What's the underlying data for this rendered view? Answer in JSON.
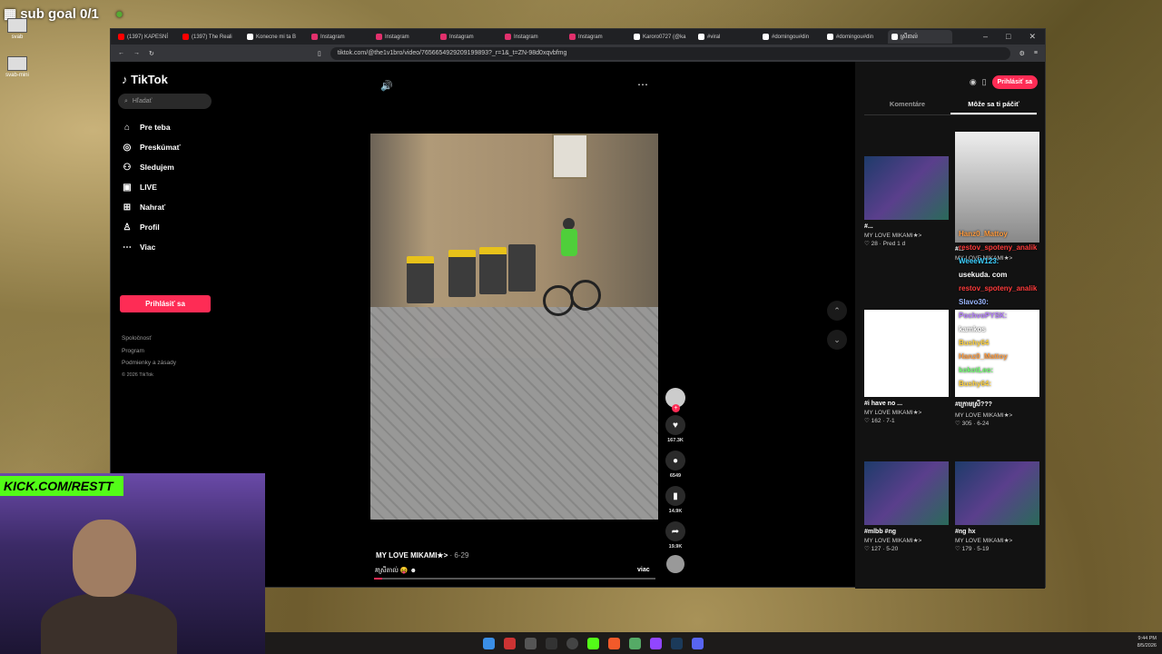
{
  "overlay": {
    "sub_goal": "sub goal 0/1"
  },
  "desktop": {
    "icons": [
      "svab",
      "svab-mini"
    ]
  },
  "browser": {
    "tabs": [
      {
        "label": "(1397) KAPESNÍ",
        "color": "#ff0000"
      },
      {
        "label": "(1397) The Reali",
        "color": "#ff0000"
      },
      {
        "label": "Konecne mi ta B",
        "color": "#ffffff"
      },
      {
        "label": "Instagram",
        "color": "#e1306c"
      },
      {
        "label": "Instagram",
        "color": "#e1306c"
      },
      {
        "label": "Instagram",
        "color": "#e1306c"
      },
      {
        "label": "Instagram",
        "color": "#e1306c"
      },
      {
        "label": "Instagram",
        "color": "#e1306c"
      },
      {
        "label": "Karoro0727 (@ka",
        "color": "#ffffff"
      },
      {
        "label": "#viral",
        "color": "#ffffff"
      },
      {
        "label": "#domingou#din",
        "color": "#ffffff"
      },
      {
        "label": "#domingou#din",
        "color": "#ffffff"
      },
      {
        "label": "ស្រីតាល់",
        "color": "#ffffff",
        "active": true
      }
    ],
    "url": "tiktok.com/@the1v1bro/video/7656654929209199893?_r=1&_t=ZN-98d0xqvbfmg"
  },
  "tiktok": {
    "logo": "TikTok",
    "search_placeholder": "Hľadať",
    "nav": [
      {
        "label": "Pre teba",
        "icon": "home-icon",
        "glyph": "⌂"
      },
      {
        "label": "Preskúmať",
        "icon": "compass-icon",
        "glyph": "◎"
      },
      {
        "label": "Sledujem",
        "icon": "user-follow-icon",
        "glyph": "⚇"
      },
      {
        "label": "LIVE",
        "icon": "live-icon",
        "glyph": "▣"
      },
      {
        "label": "Nahrať",
        "icon": "upload-icon",
        "glyph": "⊞"
      },
      {
        "label": "Profil",
        "icon": "profile-icon",
        "glyph": "♙"
      },
      {
        "label": "Viac",
        "icon": "more-icon",
        "glyph": "⋯"
      }
    ],
    "login": "Prihlásiť sa",
    "footer": [
      "Spoločnosť",
      "Program",
      "Podmienky a zásady"
    ],
    "copyright": "© 2026 TikTok",
    "video": {
      "author": "MY LOVE MIKAMI★>",
      "date": " · 6-29",
      "tags": "#ស្រីតាល់ 😝 ☻",
      "more": "viac",
      "likes": "167.3K",
      "comments": "6549",
      "saves": "14.9K",
      "shares": "19.9K",
      "progress": 0.03
    },
    "right": {
      "login": "Prihlásiť sa",
      "tabs": [
        "Komentáre",
        "Môže sa ti páčiť"
      ],
      "cards": [
        {
          "title": "#...",
          "author": "MY LOVE MIKAMI★>",
          "stats": "♡ 28 · Pred 1 d"
        },
        {
          "title": "#...",
          "author": "MY LOVE MIKAMI★>",
          "stats": ""
        },
        {
          "title": "#i have no ...",
          "author": "MY LOVE MIKAMI★>",
          "stats": "♡ 162 · 7-1"
        },
        {
          "title": "#ក្រោមស្រី???",
          "author": "MY LOVE MIKAMI★>",
          "stats": "♡ 305 · 6-24"
        },
        {
          "title": "#mlbb #ng",
          "author": "MY LOVE MIKAMI★>",
          "stats": "♡ 127 · 5-20"
        },
        {
          "title": "#ng hx",
          "author": "MY LOVE MIKAMI★>",
          "stats": "♡ 179 · 5-19"
        }
      ]
    }
  },
  "chat": [
    {
      "name": "Hanz0_Mattoy",
      "color": "#ff9a3c"
    },
    {
      "name": "restov_spoteny_analik",
      "color": "#ff3b3b"
    },
    {
      "name": "WeeeW123:",
      "color": "#3ccfff"
    },
    {
      "name": "usekuda. com",
      "color": "#ffffff"
    },
    {
      "name": "restov_spoteny_analik",
      "color": "#ff3b3b"
    },
    {
      "name": "Slavo30:",
      "color": "#9ab6ff"
    },
    {
      "name": "PochvoPYSK:",
      "color": "#b57cff"
    },
    {
      "name": "kamkos",
      "color": "#ffffff"
    },
    {
      "name": "Bushy64",
      "color": "#ffd23c"
    },
    {
      "name": "Hanz0_Mattoy",
      "color": "#ff9a3c"
    },
    {
      "name": "kokotLeo:",
      "color": "#6cff6c"
    },
    {
      "name": "Bushy64:",
      "color": "#ffd23c"
    }
  ],
  "kick": "KICK.COM/RESTT",
  "clock": {
    "time": "9:44 PM",
    "date": "8/5/2026"
  }
}
